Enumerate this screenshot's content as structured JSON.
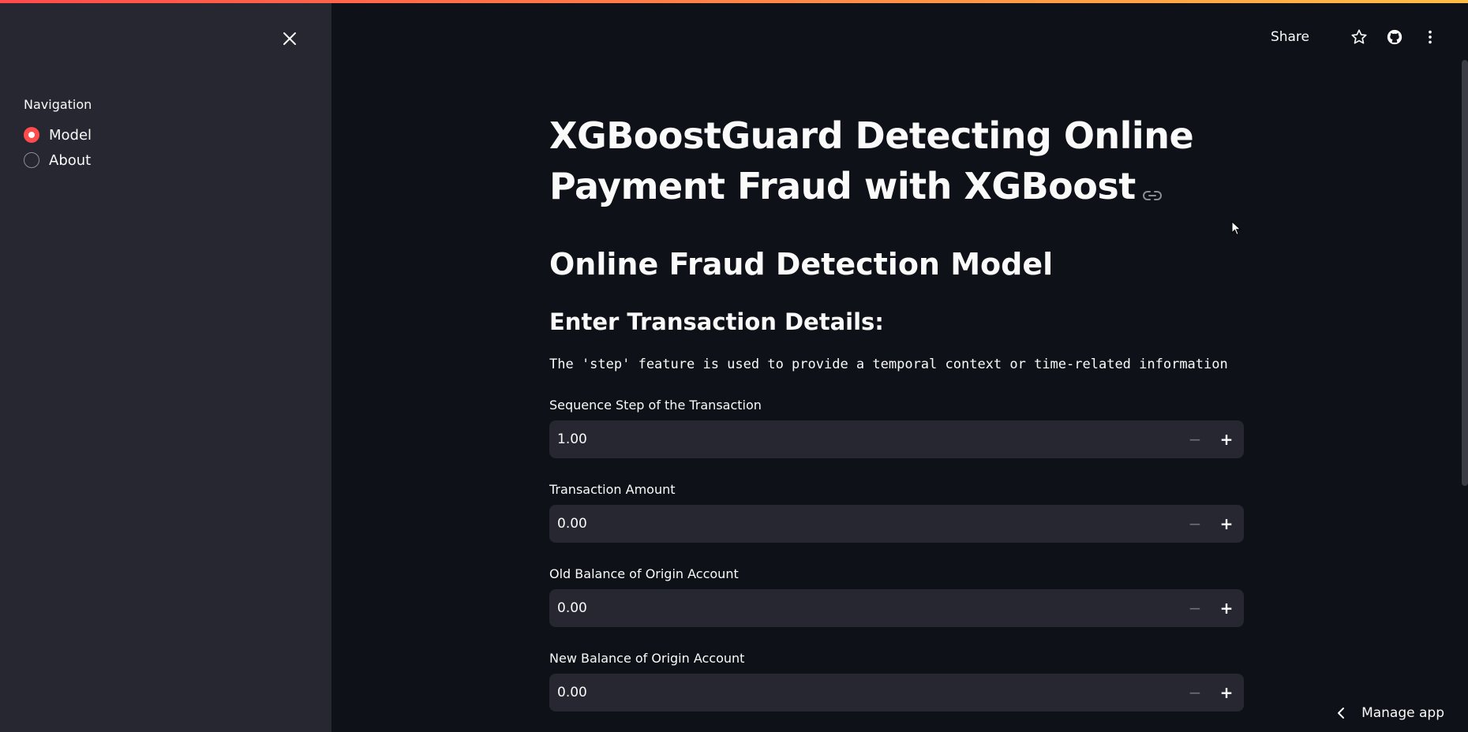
{
  "sidebar": {
    "close_icon": "close-icon",
    "nav_label": "Navigation",
    "items": [
      {
        "label": "Model",
        "selected": true
      },
      {
        "label": "About",
        "selected": false
      }
    ]
  },
  "topbar": {
    "share_label": "Share",
    "icons": [
      "star-icon",
      "github-icon",
      "more-vertical-icon"
    ]
  },
  "main": {
    "title": "XGBoostGuard Detecting Online Payment Fraud with XGBoost",
    "subtitle": "Online Fraud Detection Model",
    "section_heading": "Enter Transaction Details:",
    "code_text": "The 'step' feature is used to provide a temporal context or time-related information",
    "fields": [
      {
        "label": "Sequence Step of the Transaction",
        "value": "1.00"
      },
      {
        "label": "Transaction Amount",
        "value": "0.00"
      },
      {
        "label": "Old Balance of Origin Account",
        "value": "0.00"
      },
      {
        "label": "New Balance of Origin Account",
        "value": "0.00"
      }
    ]
  },
  "footer": {
    "manage_app_label": "Manage app"
  },
  "colors": {
    "accent": "#ff4b4b",
    "background": "#0e1117",
    "sidebar": "#262730",
    "input": "#262730"
  }
}
